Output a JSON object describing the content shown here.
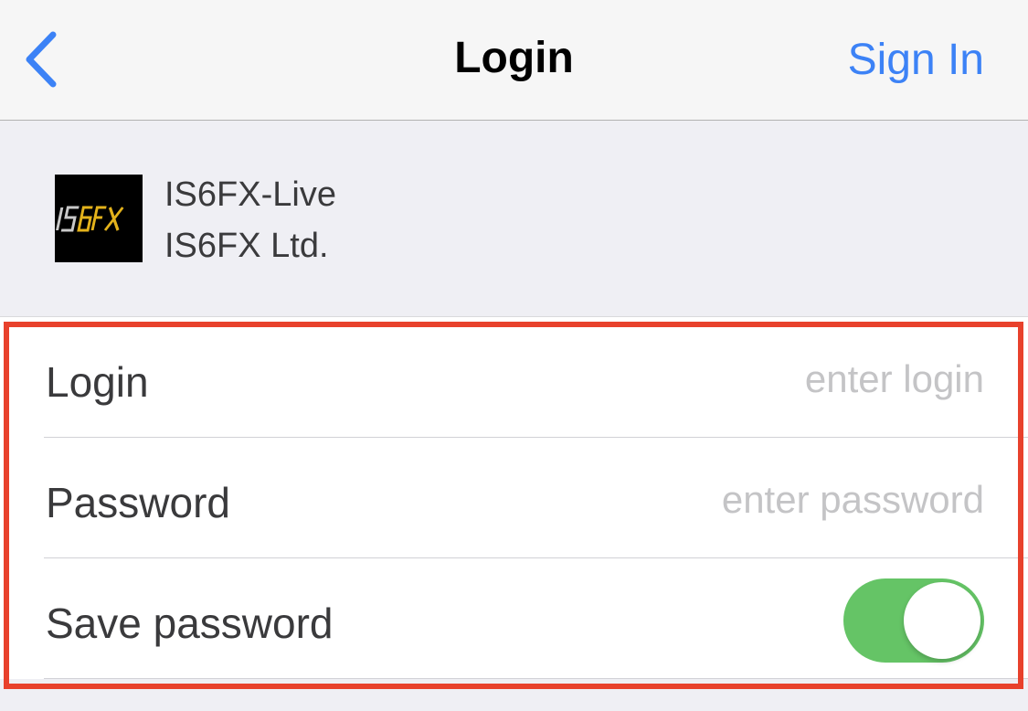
{
  "nav": {
    "back_icon": "chevron-left-icon",
    "title": "Login",
    "sign_in_label": "Sign In",
    "accent_color": "#3c82f6"
  },
  "server": {
    "logo_text": "IS6FX",
    "name": "IS6FX-Live",
    "company": "IS6FX Ltd."
  },
  "form": {
    "login": {
      "label": "Login",
      "value": "",
      "placeholder": "enter login"
    },
    "password": {
      "label": "Password",
      "value": "",
      "placeholder": "enter password"
    },
    "save_password": {
      "label": "Save password",
      "enabled": true,
      "toggle_color": "#65c466"
    }
  },
  "highlight_color": "#e8412c"
}
